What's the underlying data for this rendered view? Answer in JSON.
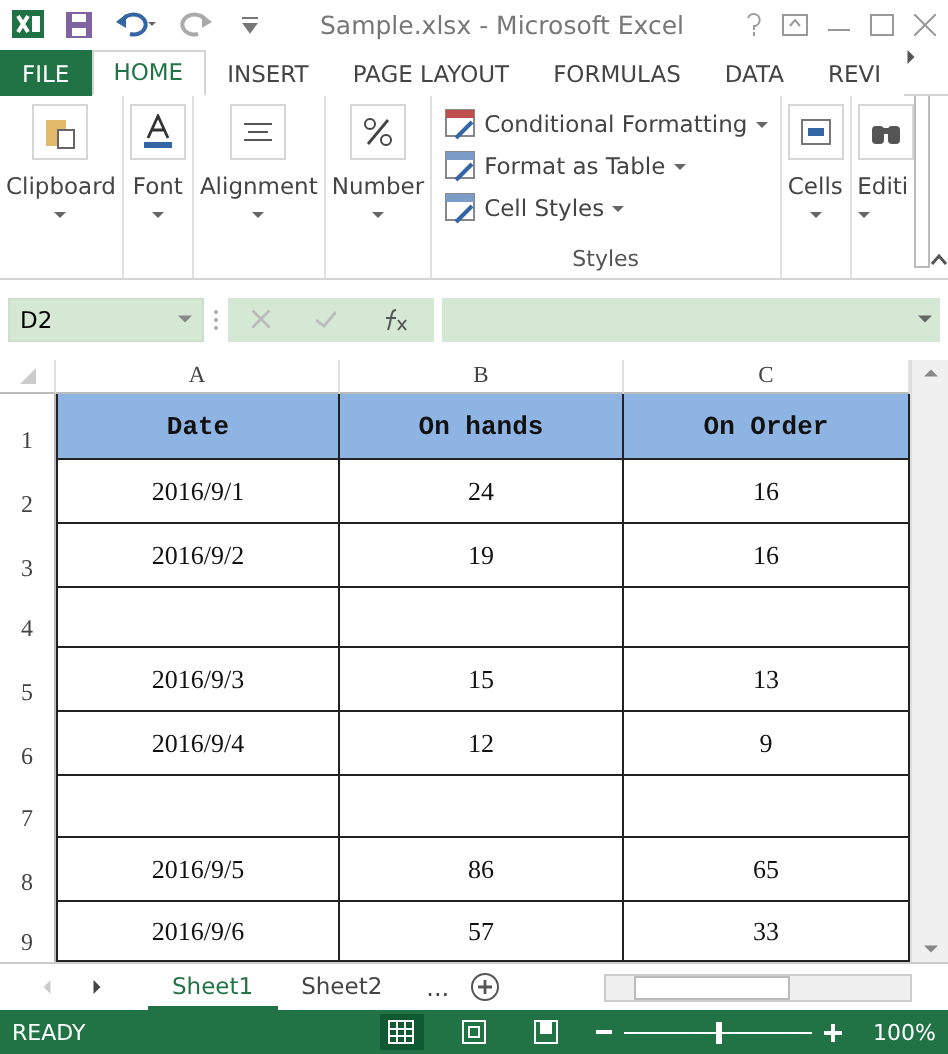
{
  "window": {
    "title": "Sample.xlsx - Microsoft Excel"
  },
  "ribbon_tabs": [
    {
      "label": "FILE",
      "kind": "file",
      "selected": false
    },
    {
      "label": "HOME",
      "kind": "tab",
      "selected": true
    },
    {
      "label": "INSERT",
      "kind": "tab",
      "selected": false
    },
    {
      "label": "PAGE LAYOUT",
      "kind": "tab",
      "selected": false
    },
    {
      "label": "FORMULAS",
      "kind": "tab",
      "selected": false
    },
    {
      "label": "DATA",
      "kind": "tab",
      "selected": false
    },
    {
      "label": "REVI",
      "kind": "tab",
      "selected": false
    }
  ],
  "ribbon_groups": [
    {
      "label": "Clipboard"
    },
    {
      "label": "Font"
    },
    {
      "label": "Alignment"
    },
    {
      "label": "Number"
    }
  ],
  "styles_group": {
    "items": [
      "Conditional Formatting",
      "Format as Table",
      "Cell Styles"
    ],
    "label": "Styles"
  },
  "ribbon_groups_right": [
    {
      "label": "Cells"
    },
    {
      "label": "Editi"
    }
  ],
  "formula_bar": {
    "name_box": "D2"
  },
  "columns": [
    "A",
    "B",
    "C"
  ],
  "header_row": {
    "number": "1",
    "cells": [
      "Date",
      "On hands",
      "On Order"
    ]
  },
  "rows": [
    {
      "number": "2",
      "cells": [
        "2016/9/1",
        "24",
        "16"
      ]
    },
    {
      "number": "3",
      "cells": [
        "2016/9/2",
        "19",
        "16"
      ]
    },
    {
      "number": "4",
      "cells": [
        "",
        "",
        ""
      ]
    },
    {
      "number": "5",
      "cells": [
        "2016/9/3",
        "15",
        "13"
      ]
    },
    {
      "number": "6",
      "cells": [
        "2016/9/4",
        "12",
        "9"
      ]
    },
    {
      "number": "7",
      "cells": [
        "",
        "",
        ""
      ]
    },
    {
      "number": "8",
      "cells": [
        "2016/9/5",
        "86",
        "65"
      ]
    },
    {
      "number": "9",
      "cells": [
        "2016/9/6",
        "57",
        "33"
      ]
    }
  ],
  "sheet_tabs": [
    {
      "label": "Sheet1",
      "selected": true
    },
    {
      "label": "Sheet2",
      "selected": false
    }
  ],
  "more_sheets": "...",
  "status_bar": {
    "status": "READY",
    "zoom_slider": {
      "level": 0.5
    },
    "zoom": "100%"
  }
}
